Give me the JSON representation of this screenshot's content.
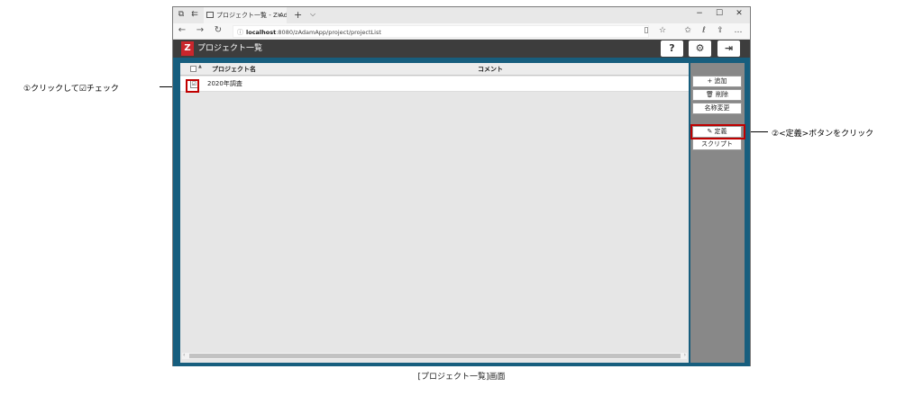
{
  "browser": {
    "tab_title": "プロジェクト一覧 - Z-Adar",
    "tab_close": "×",
    "new_tab": "+",
    "tab_dropdown": "⌵",
    "win_min": "−",
    "win_max": "☐",
    "win_close": "✕",
    "url_host": "localhost",
    "url_path": ":8080/zAdamApp/project/projectList",
    "icons": {
      "tab_actions": "tab-actions-icon",
      "tab_back": "tabs-aside-icon",
      "back": "←",
      "forward": "→",
      "refresh": "↻",
      "info": "ⓘ",
      "reading": "▯",
      "favorite": "☆",
      "favorites_bar": "✩",
      "ink": "ℓ",
      "share": "⇪",
      "more": "…"
    }
  },
  "app": {
    "logo": "Z",
    "title": "プロジェクト一覧",
    "help_icon": "?",
    "settings_icon": "⚙",
    "logout_icon": "⇥",
    "list": {
      "col_name": "プロジェクト名",
      "col_comment": "コメント",
      "sort_mark": "▲",
      "rows": [
        {
          "name": "2020年調査",
          "checked": "☑"
        }
      ]
    },
    "side_buttons": {
      "add": "+ 追加",
      "delete": "🗑 削除",
      "rename": "名称変更",
      "define": "✎ 定義",
      "script": "スクリプト"
    }
  },
  "annotations": {
    "step1": "①クリックして☑チェック",
    "step2": "②<定義>ボタンをクリック"
  },
  "caption": "[プロジェクト一覧]画面",
  "colors": {
    "header": "#3d3d3d",
    "frame": "#175e7e",
    "logo": "#c9262c",
    "highlight": "#c00000"
  }
}
